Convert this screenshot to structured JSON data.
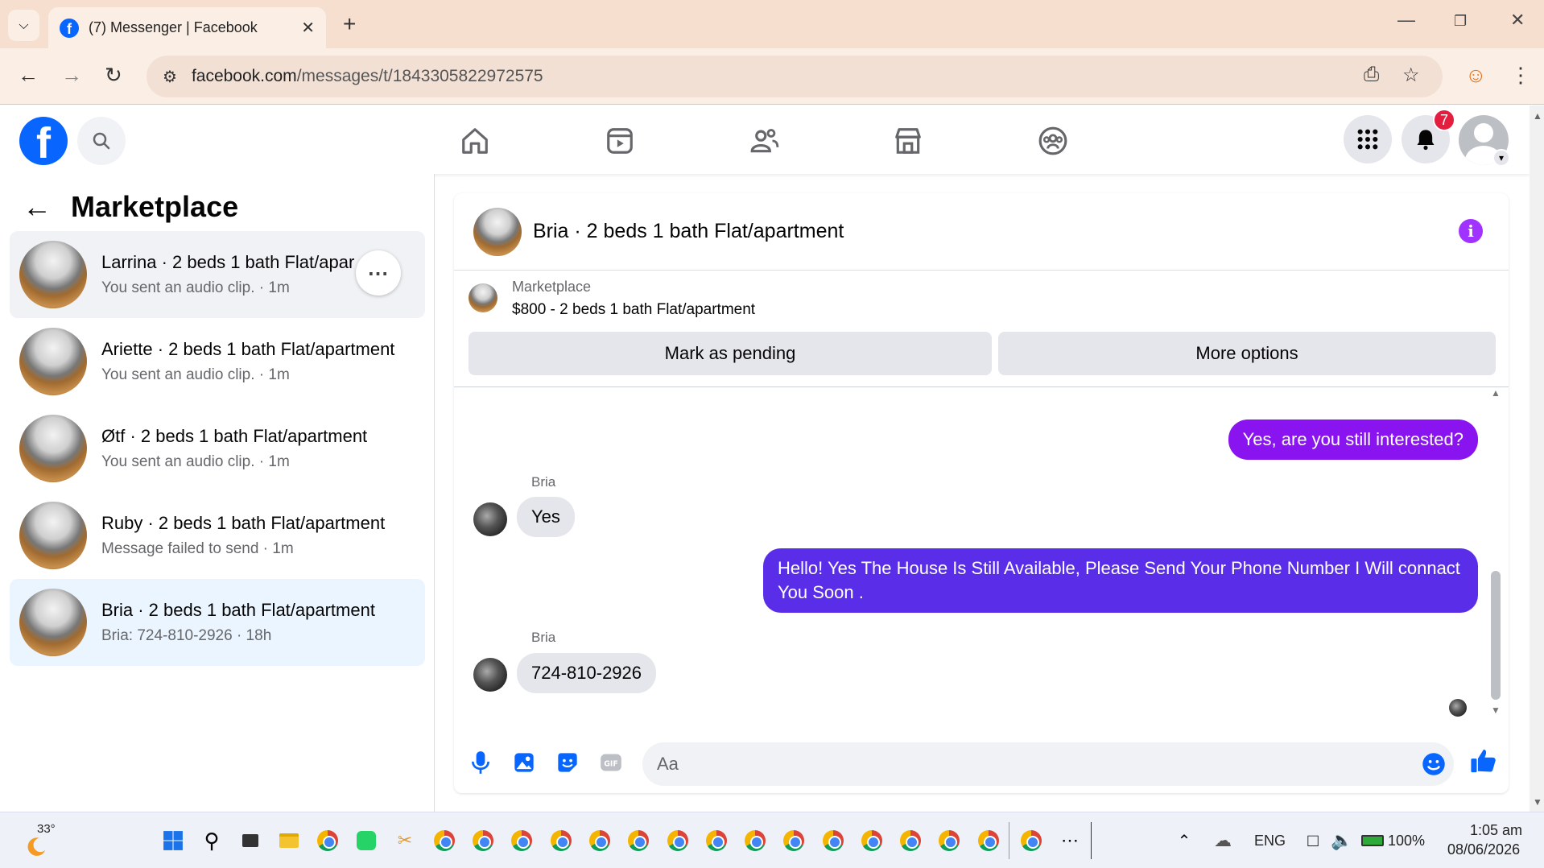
{
  "browser": {
    "tab_title": "(7) Messenger | Facebook",
    "url_host": "facebook.com",
    "url_path": "/messages/t/1843305822972575"
  },
  "header": {
    "notification_count": "7"
  },
  "left_panel": {
    "title": "Marketplace",
    "conversations": [
      {
        "name": "Larrina · 2 beds 1 bath Flat/apartment",
        "sub": "You sent an audio clip. · 1m"
      },
      {
        "name": "Ariette · 2 beds 1 bath Flat/apartment",
        "sub": "You sent an audio clip. · 1m"
      },
      {
        "name": "Øtf · 2 beds 1 bath Flat/apartment",
        "sub": "You sent an audio clip. · 1m"
      },
      {
        "name": "Ruby · 2 beds 1 bath Flat/apartment",
        "sub": "Message failed to send · 1m"
      },
      {
        "name": "Bria · 2 beds 1 bath Flat/apartment",
        "sub": "Bria: 724-810-2926 · 18h"
      }
    ]
  },
  "chat": {
    "title": "Bria · 2 beds 1 bath Flat/apartment",
    "marketplace_label": "Marketplace",
    "listing": "$800 - 2 beds 1 bath Flat/apartment",
    "mark_pending": "Mark as pending",
    "more_options": "More options",
    "messages": {
      "out1": "Yes, are you still interested?",
      "sender1": "Bria",
      "in1": "Yes",
      "out2": "Hello! Yes The House  Is Still Available, Please Send Your Phone Number I Will connact You Soon .",
      "sender2": "Bria",
      "in2": "724-810-2926"
    },
    "composer_placeholder": "Aa"
  },
  "taskbar": {
    "temperature": "33°",
    "language": "ENG",
    "battery": "100%",
    "time": "1:05 am",
    "date": "08/06/2026"
  },
  "colors": {
    "accent": "#0866ff",
    "outgoing_bubble": "#8a14f0",
    "outgoing_bubble_2": "#5a2ee8",
    "info": "#a033ff"
  }
}
